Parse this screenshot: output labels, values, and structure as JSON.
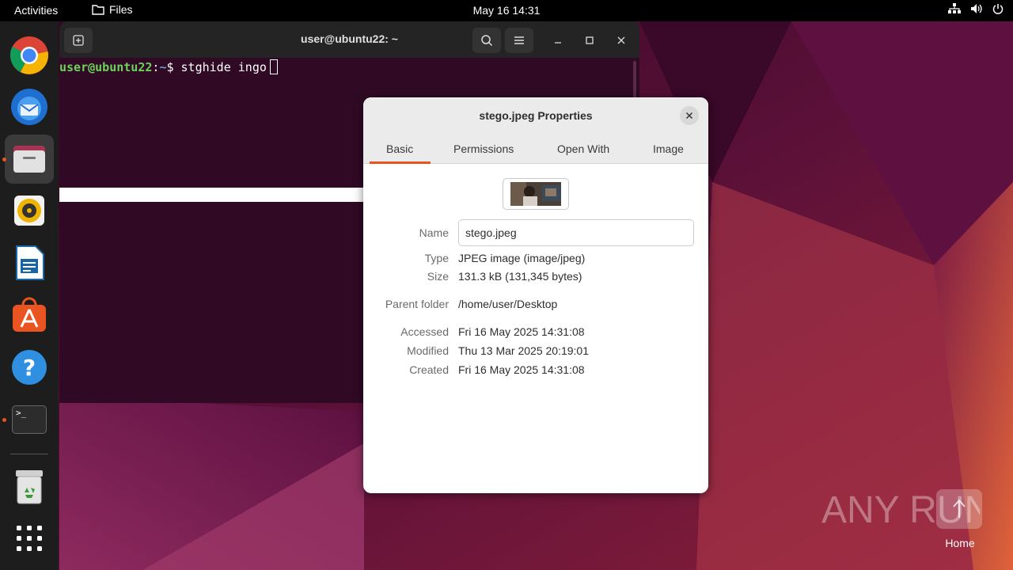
{
  "topbar": {
    "activities": "Activities",
    "app_name": "Files",
    "clock": "May 16  14:31"
  },
  "dock": {
    "items": [
      {
        "name": "chrome-icon",
        "running": false
      },
      {
        "name": "thunderbird-icon",
        "running": false
      },
      {
        "name": "files-icon",
        "running": true
      },
      {
        "name": "rhythmbox-icon",
        "running": false
      },
      {
        "name": "libreoffice-writer-icon",
        "running": false
      },
      {
        "name": "app-center-icon",
        "running": false
      },
      {
        "name": "help-icon",
        "running": false
      },
      {
        "name": "terminal-icon",
        "running": true
      },
      {
        "name": "trash-icon",
        "running": false
      },
      {
        "name": "show-apps-icon",
        "running": false
      }
    ],
    "terminal_glyph": ">_"
  },
  "terminal": {
    "title": "user@ubuntu22: ~",
    "prompt_user": "user@ubuntu22",
    "prompt_sep": ":",
    "prompt_path": "~",
    "prompt_symbol": "$ ",
    "command": "stghide ingo"
  },
  "properties": {
    "title": "stego.jpeg Properties",
    "tabs": [
      "Basic",
      "Permissions",
      "Open With",
      "Image"
    ],
    "active_tab": "Basic",
    "name_label": "Name",
    "name_value": "stego.jpeg",
    "type_label": "Type",
    "type_value": "JPEG image (image/jpeg)",
    "size_label": "Size",
    "size_value": "131.3 kB (131,345 bytes)",
    "parent_label": "Parent folder",
    "parent_value": "/home/user/Desktop",
    "accessed_label": "Accessed",
    "accessed_value": "Fri 16 May 2025 14:31:08",
    "modified_label": "Modified",
    "modified_value": "Thu 13 Mar 2025 20:19:01",
    "created_label": "Created",
    "created_value": "Fri 16 May 2025 14:31:08"
  },
  "desktop": {
    "home_label": "Home",
    "watermark": "ANY RUN"
  },
  "colors": {
    "accent": "#e95420",
    "terminal_bg": "#300a24",
    "topbar_bg": "#000000",
    "dock_bg": "#1d1d1d"
  }
}
